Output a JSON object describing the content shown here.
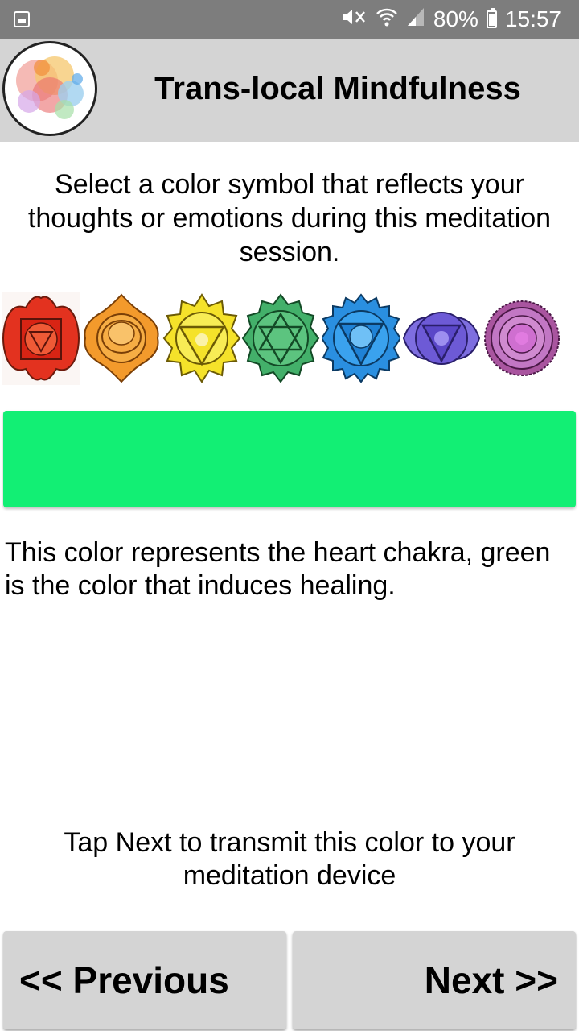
{
  "status_bar": {
    "battery": "80%",
    "time": "15:57"
  },
  "app_bar": {
    "title": "Trans-local Mindfulness"
  },
  "instruction": "Select a color symbol that reflects your thoughts or emotions during this meditation session.",
  "chakras": [
    {
      "name": "root-chakra",
      "color": "#e3321f"
    },
    {
      "name": "sacral-chakra",
      "color": "#f39a2c"
    },
    {
      "name": "solar-plexus-chakra",
      "color": "#f5e22a"
    },
    {
      "name": "heart-chakra",
      "color": "#43b06a"
    },
    {
      "name": "throat-chakra",
      "color": "#2a8fe0"
    },
    {
      "name": "third-eye-chakra",
      "color": "#6d5ad6"
    },
    {
      "name": "crown-chakra",
      "color": "#c277c4"
    }
  ],
  "selected_color": "#12ef74",
  "description": "This color represents the heart chakra, green is the color that induces healing.",
  "hint": "Tap Next to transmit this color to your meditation device",
  "buttons": {
    "previous": "<< Previous",
    "next": "Next >>"
  }
}
